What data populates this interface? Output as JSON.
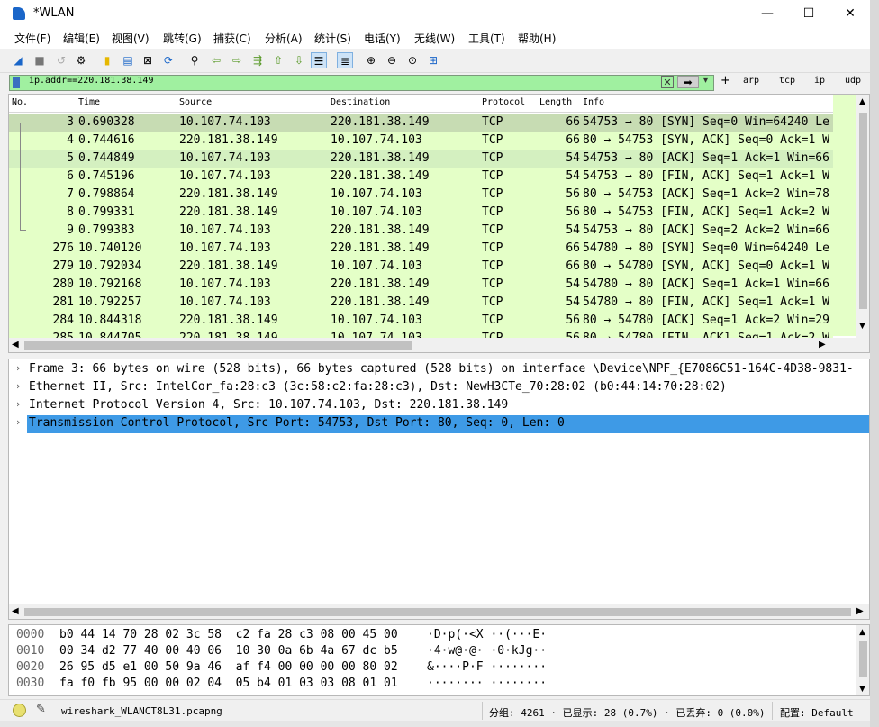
{
  "window": {
    "title": "*WLAN",
    "minimize": "—",
    "maximize": "☐",
    "close": "✕"
  },
  "menu": [
    "文件(F)",
    "编辑(E)",
    "视图(V)",
    "跳转(G)",
    "捕获(C)",
    "分析(A)",
    "统计(S)",
    "电话(Y)",
    "无线(W)",
    "工具(T)",
    "帮助(H)"
  ],
  "filter": {
    "value": "ip.addr==220.181.38.149",
    "plus": "+",
    "buttons": [
      "arp",
      "tcp",
      "ip",
      "udp"
    ]
  },
  "packet_list": {
    "columns": [
      "No.",
      "Time",
      "Source",
      "Destination",
      "Protocol",
      "Length",
      "Info"
    ],
    "rows": [
      {
        "no": "3",
        "time": "0.690328",
        "src": "10.107.74.103",
        "dst": "220.181.38.149",
        "proto": "TCP",
        "len": "66",
        "info": "54753 → 80 [SYN] Seq=0 Win=64240 Le"
      },
      {
        "no": "4",
        "time": "0.744616",
        "src": "220.181.38.149",
        "dst": "10.107.74.103",
        "proto": "TCP",
        "len": "66",
        "info": "80 → 54753 [SYN, ACK] Seq=0 Ack=1 W"
      },
      {
        "no": "5",
        "time": "0.744849",
        "src": "10.107.74.103",
        "dst": "220.181.38.149",
        "proto": "TCP",
        "len": "54",
        "info": "54753 → 80 [ACK] Seq=1 Ack=1 Win=66"
      },
      {
        "no": "6",
        "time": "0.745196",
        "src": "10.107.74.103",
        "dst": "220.181.38.149",
        "proto": "TCP",
        "len": "54",
        "info": "54753 → 80 [FIN, ACK] Seq=1 Ack=1 W"
      },
      {
        "no": "7",
        "time": "0.798864",
        "src": "220.181.38.149",
        "dst": "10.107.74.103",
        "proto": "TCP",
        "len": "56",
        "info": "80 → 54753 [ACK] Seq=1 Ack=2 Win=78"
      },
      {
        "no": "8",
        "time": "0.799331",
        "src": "220.181.38.149",
        "dst": "10.107.74.103",
        "proto": "TCP",
        "len": "56",
        "info": "80 → 54753 [FIN, ACK] Seq=1 Ack=2 W"
      },
      {
        "no": "9",
        "time": "0.799383",
        "src": "10.107.74.103",
        "dst": "220.181.38.149",
        "proto": "TCP",
        "len": "54",
        "info": "54753 → 80 [ACK] Seq=2 Ack=2 Win=66"
      },
      {
        "no": "276",
        "time": "10.740120",
        "src": "10.107.74.103",
        "dst": "220.181.38.149",
        "proto": "TCP",
        "len": "66",
        "info": "54780 → 80 [SYN] Seq=0 Win=64240 Le"
      },
      {
        "no": "279",
        "time": "10.792034",
        "src": "220.181.38.149",
        "dst": "10.107.74.103",
        "proto": "TCP",
        "len": "66",
        "info": "80 → 54780 [SYN, ACK] Seq=0 Ack=1 W"
      },
      {
        "no": "280",
        "time": "10.792168",
        "src": "10.107.74.103",
        "dst": "220.181.38.149",
        "proto": "TCP",
        "len": "54",
        "info": "54780 → 80 [ACK] Seq=1 Ack=1 Win=66"
      },
      {
        "no": "281",
        "time": "10.792257",
        "src": "10.107.74.103",
        "dst": "220.181.38.149",
        "proto": "TCP",
        "len": "54",
        "info": "54780 → 80 [FIN, ACK] Seq=1 Ack=1 W"
      },
      {
        "no": "284",
        "time": "10.844318",
        "src": "220.181.38.149",
        "dst": "10.107.74.103",
        "proto": "TCP",
        "len": "56",
        "info": "80 → 54780 [ACK] Seq=1 Ack=2 Win=29"
      },
      {
        "no": "285",
        "time": "10.844705",
        "src": "220.181.38.149",
        "dst": "10.107.74.103",
        "proto": "TCP",
        "len": "56",
        "info": "80 → 54780 [FIN, ACK] Seq=1 Ack=2 W"
      }
    ]
  },
  "details": [
    "Frame 3: 66 bytes on wire (528 bits), 66 bytes captured (528 bits) on interface \\Device\\NPF_{E7086C51-164C-4D38-9831-",
    "Ethernet II, Src: IntelCor_fa:28:c3 (3c:58:c2:fa:28:c3), Dst: NewH3CTe_70:28:02 (b0:44:14:70:28:02)",
    "Internet Protocol Version 4, Src: 10.107.74.103, Dst: 220.181.38.149",
    "Transmission Control Protocol, Src Port: 54753, Dst Port: 80, Seq: 0, Len: 0"
  ],
  "bytes": [
    {
      "off": "0000",
      "hex": "b0 44 14 70 28 02 3c 58  c2 fa 28 c3 08 00 45 00",
      "ascii": "·D·p(·<X ··(···E·"
    },
    {
      "off": "0010",
      "hex": "00 34 d2 77 40 00 40 06  10 30 0a 6b 4a 67 dc b5",
      "ascii": "·4·w@·@· ·0·kJg··"
    },
    {
      "off": "0020",
      "hex": "26 95 d5 e1 00 50 9a 46  af f4 00 00 00 00 80 02",
      "ascii": "&····P·F ········"
    },
    {
      "off": "0030",
      "hex": "fa f0 fb 95 00 00 02 04  05 b4 01 03 03 08 01 01",
      "ascii": "········ ········"
    }
  ],
  "status": {
    "file": "wireshark_WLANCT8L31.pcapng",
    "packets": "分组: 4261 · 已显示: 28 (0.7%) · 已丢弃: 0 (0.0%)",
    "profile": "配置: Default"
  },
  "colors": {
    "tcp_row": "#e4ffc7",
    "selected_row": "#c7dcb3",
    "selected_detail": "#3e9ae6",
    "filter_ok": "#a0f0a0"
  }
}
